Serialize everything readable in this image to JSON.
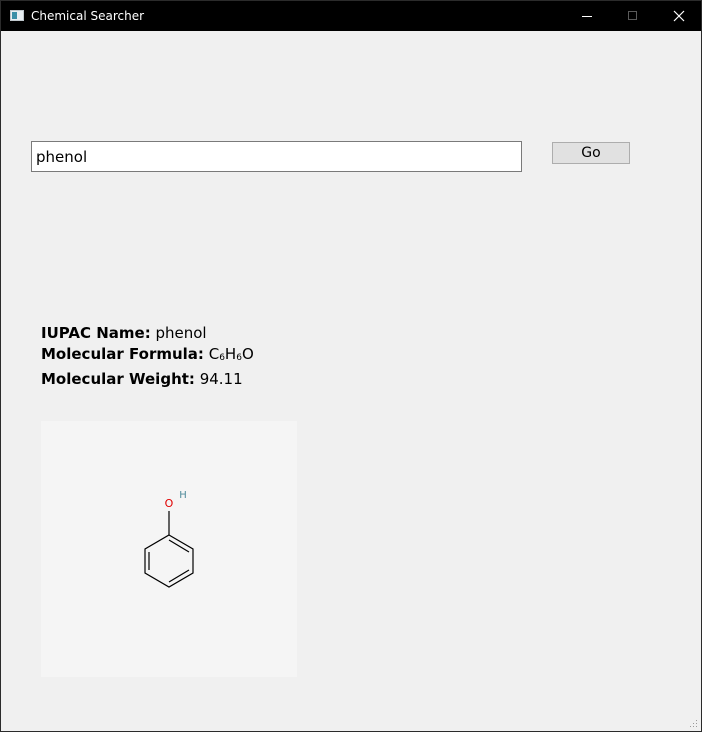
{
  "window": {
    "title": "Chemical Searcher"
  },
  "search": {
    "query": "phenol",
    "go_label": "Go"
  },
  "result": {
    "iupac_label": "IUPAC Name:",
    "iupac_value": "phenol",
    "formula_label": "Molecular Formula:",
    "formula_parts": {
      "c": "C",
      "c_n": "6",
      "h": "H",
      "h_n": "6",
      "o": "O"
    },
    "weight_label": "Molecular Weight:",
    "weight_value": "94.11"
  },
  "structure": {
    "oxygen_label": "O",
    "hydrogen_label": "H",
    "oxygen_color": "#e00000",
    "hydrogen_color": "#4e8a9a"
  },
  "colors": {
    "titlebar": "#000000",
    "window_bg": "#f0f0f0",
    "structure_bg": "#f5f5f5"
  }
}
